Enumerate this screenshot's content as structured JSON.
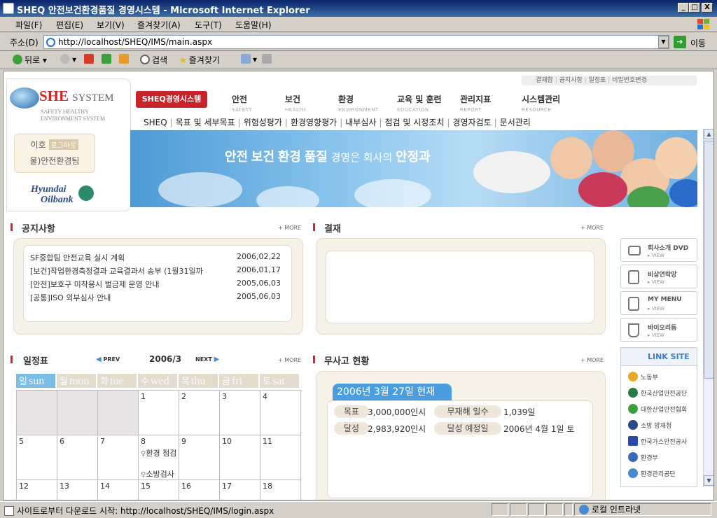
{
  "window": {
    "title": "SHEQ 안전보건환경품질 경영시스템 - Microsoft Internet Explorer",
    "min_label": "_",
    "max_label": "□",
    "close_label": "X"
  },
  "menu": [
    "파일(F)",
    "편집(E)",
    "보기(V)",
    "즐겨찾기(A)",
    "도구(T)",
    "도움말(H)"
  ],
  "address": {
    "label": "주소(D)",
    "url": "http://localhost/SHEQ/IMS/main.aspx",
    "go_label": "이동"
  },
  "toolbar": {
    "back": "뒤로",
    "search": "검색",
    "favorites": "즐겨찾기"
  },
  "logo": {
    "brand": "SHE",
    "system": "SYSTEM",
    "sub1": "SAFETY HEALTHY",
    "sub2": "ENVIRONMENT SYSTEM"
  },
  "user": {
    "name": "이호",
    "logout": "로그아웃",
    "team": "울)안전환경팀"
  },
  "company": {
    "line1": "Hyundai",
    "line2": "Oilbank"
  },
  "util_links": [
    "결재함",
    "공지사항",
    "일정표",
    "비밀번호변경"
  ],
  "nav": {
    "active": "SHEQ경영시스템",
    "items": [
      {
        "k": "안전",
        "e": "SAFETY"
      },
      {
        "k": "보건",
        "e": "HEALTH"
      },
      {
        "k": "환경",
        "e": "ENVIRONMENT"
      },
      {
        "k": "교육 및 훈련",
        "e": "EDUCATION"
      },
      {
        "k": "관리지표",
        "e": "REPORT"
      },
      {
        "k": "시스템관리",
        "e": "RESOURCE"
      }
    ]
  },
  "subnav": [
    "SHEQ",
    "목표 및 세부목표",
    "위험성평가",
    "환경영향평가",
    "내부심사",
    "점검 및 시정조치",
    "경영자검토",
    "문서관리"
  ],
  "banner": {
    "w1": "안전",
    "w2": "보건",
    "w3": "환경",
    "w4": "품질",
    "w5": "경영은 회사의",
    "w6": "안정과"
  },
  "notice": {
    "title": "공지사항",
    "more": "+ MORE",
    "rows": [
      {
        "title": "SF중합팀 안전교육 실시 계획",
        "date": "2006,02,22"
      },
      {
        "title": "[보건]작업환경측정결과 교육결과서 송부 (1월31일까",
        "date": "2006,01,17"
      },
      {
        "title": "[안전]보호구 미착용시 벌금제 운영 안내",
        "date": "2005,06,03"
      },
      {
        "title": "[공통]ISO 외부심사 안내",
        "date": "2005,06,03"
      }
    ]
  },
  "approval": {
    "title": "결재",
    "more": "+ MORE"
  },
  "schedule": {
    "title": "일정표",
    "prev": "PREV",
    "month": "2006/3",
    "next": "NEXT",
    "more": "+ MORE",
    "dow": [
      {
        "k": "일",
        "e": "sun",
        "color": "#7bbde6"
      },
      {
        "k": "월",
        "e": "mon",
        "color": "#e2dccd"
      },
      {
        "k": "화",
        "e": "tue",
        "color": "#e2dccd"
      },
      {
        "k": "수",
        "e": "wed",
        "color": "#e2dccd"
      },
      {
        "k": "목",
        "e": "thu",
        "color": "#e2dccd"
      },
      {
        "k": "금",
        "e": "fri",
        "color": "#e2dccd"
      },
      {
        "k": "토",
        "e": "sat",
        "color": "#e2dccd"
      }
    ],
    "weeks": [
      [
        "",
        "",
        "",
        "1",
        "2",
        "3",
        "4"
      ],
      [
        "5",
        "6",
        "7",
        "8",
        "9",
        "10",
        "11"
      ],
      [
        "12",
        "13",
        "14",
        "15",
        "16",
        "17",
        "18"
      ]
    ],
    "events": {
      "e1": "환경 점검",
      "e2": "소방검사"
    }
  },
  "accident": {
    "title": "무사고 현황",
    "more": "+ MORE",
    "date_label": "2006년 3월 27일 현재",
    "target_label": "목표",
    "target_value": "3,000,000인시",
    "achieved_label": "달성",
    "achieved_value": "2,983,920인시",
    "days_label": "무재해 일수",
    "days_value": "1,039일",
    "expected_label": "달성 예정일",
    "expected_value": "2006년 4월 1일 토"
  },
  "side": [
    {
      "label": "회사소개 DVD",
      "view": "▸ VIEW"
    },
    {
      "label": "비상연락망",
      "view": "▸ VIEW"
    },
    {
      "label": "MY MENU",
      "view": "▸ VIEW"
    },
    {
      "label": "바이오리듬",
      "view": "▸ VIEW"
    }
  ],
  "links": {
    "title": "LINK SITE",
    "items": [
      "노동부",
      "한국산업안전공단",
      "대한산업안전협회",
      "소방 방재청",
      "한국가스안전공사",
      "환경부",
      "환경관리공단"
    ]
  },
  "status": {
    "text": "사이트로부터 다운로드 시작: http://localhost/SHEQ/IMS/login.aspx",
    "zone": "로컬 인트라넷"
  }
}
